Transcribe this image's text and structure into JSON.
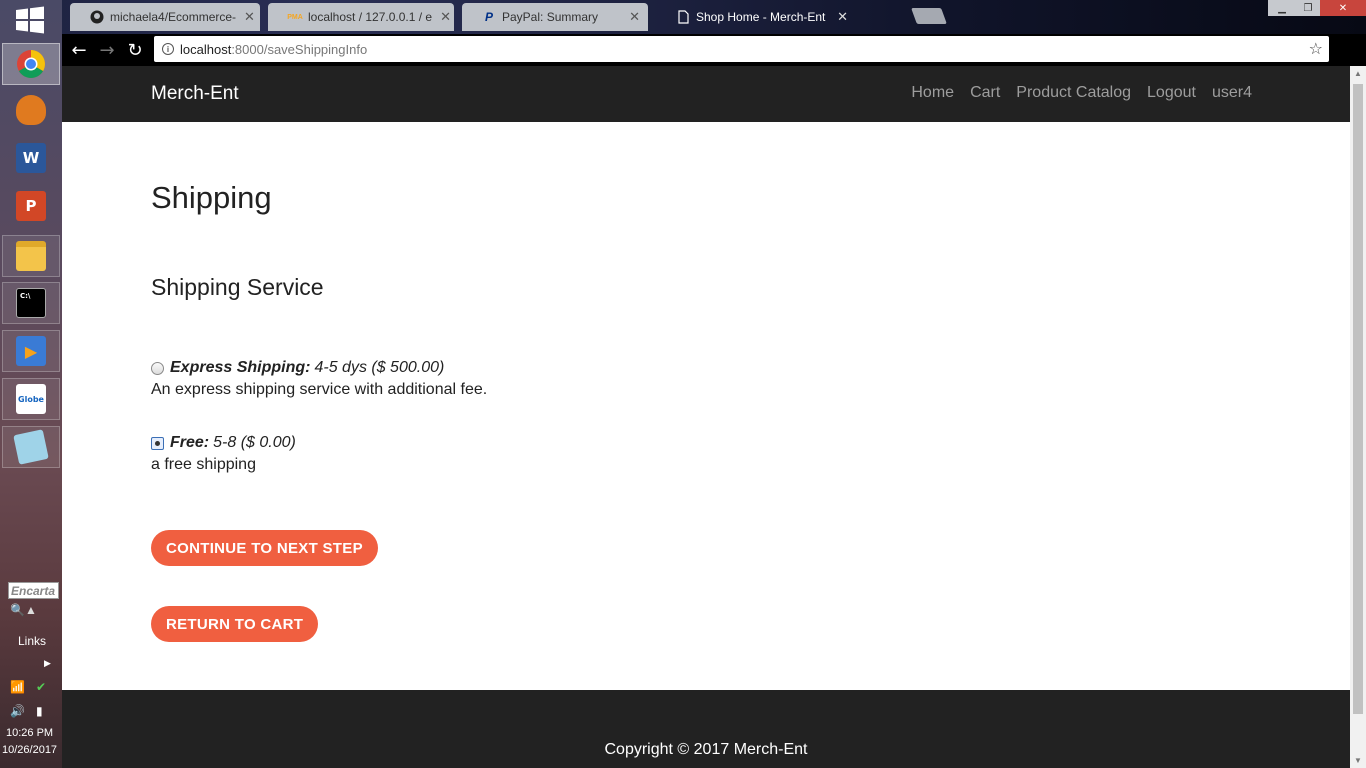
{
  "taskbar": {
    "apps": [
      {
        "name": "chrome",
        "active": true
      },
      {
        "name": "unknown-app"
      },
      {
        "name": "word"
      },
      {
        "name": "powerpoint"
      },
      {
        "name": "file-explorer"
      },
      {
        "name": "command-prompt"
      },
      {
        "name": "media-player"
      },
      {
        "name": "globe-broadband"
      },
      {
        "name": "notepad"
      }
    ],
    "encarta_placeholder": "Encarta",
    "links_label": "Links",
    "clock_time": "10:26 PM",
    "clock_date": "10/26/2017"
  },
  "browser": {
    "tabs": [
      {
        "title": "michaela4/Ecommerce-",
        "icon": "github-icon"
      },
      {
        "title": "localhost / 127.0.0.1 / e",
        "icon": "phpmyadmin-icon",
        "icon_text": "PMA"
      },
      {
        "title": "PayPal: Summary",
        "icon": "paypal-icon",
        "icon_text": "P"
      },
      {
        "title": "Shop Home - Merch-Ent",
        "icon": "document-icon",
        "active": true
      }
    ],
    "url_host": "localhost",
    "url_path": ":8000/saveShippingInfo"
  },
  "site": {
    "brand": "Merch-Ent",
    "nav": [
      "Home",
      "Cart",
      "Product Catalog",
      "Logout",
      "user4"
    ]
  },
  "main": {
    "title": "Shipping",
    "section_title": "Shipping Service",
    "options": [
      {
        "name": "Express Shipping:",
        "detail": "4-5 dys ($ 500.00)",
        "description": "An express shipping service with additional fee.",
        "selected": false
      },
      {
        "name": "Free:",
        "detail": "5-8 ($ 0.00)",
        "description": "a free shipping",
        "selected": true
      }
    ],
    "continue_label": "CONTINUE TO NEXT STEP",
    "return_label": "RETURN TO CART"
  },
  "footer": {
    "copyright": "Copyright © 2017 Merch-Ent"
  },
  "colors": {
    "accent": "#f05f40",
    "navbar": "#222222",
    "nav_link": "#9d9d9d"
  }
}
